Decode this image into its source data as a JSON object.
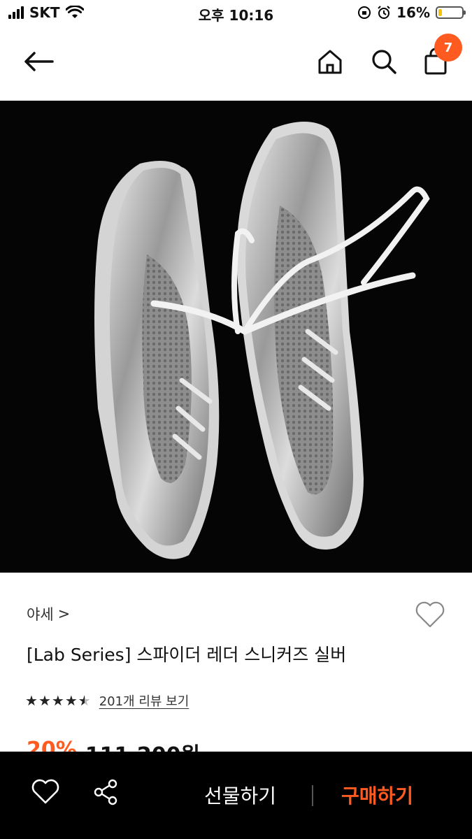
{
  "status_bar": {
    "carrier": "SKT",
    "time": "오후 10:16",
    "battery": "16%",
    "battery_level": 0.16,
    "battery_color": "#f5c400"
  },
  "nav": {
    "back_icon": "arrow-left-icon",
    "home_icon": "home-icon",
    "search_icon": "search-icon",
    "cart_icon": "shopping-bag-icon",
    "cart_count": "7",
    "accent": "#ff5a1f"
  },
  "product": {
    "image_icon": "silver-sneakers-photo",
    "brand": "야세",
    "brand_chevron": ">",
    "title": "[Lab Series] 스파이더 레더 스니커즈 실버",
    "rating_stars": 4.5,
    "review_link": "201개 리뷰 보기",
    "discount": "20%",
    "price": "111,200원"
  },
  "bottom_bar": {
    "like_icon": "heart-icon",
    "share_icon": "share-icon",
    "gift_label": "선물하기",
    "buy_label": "구매하기"
  }
}
